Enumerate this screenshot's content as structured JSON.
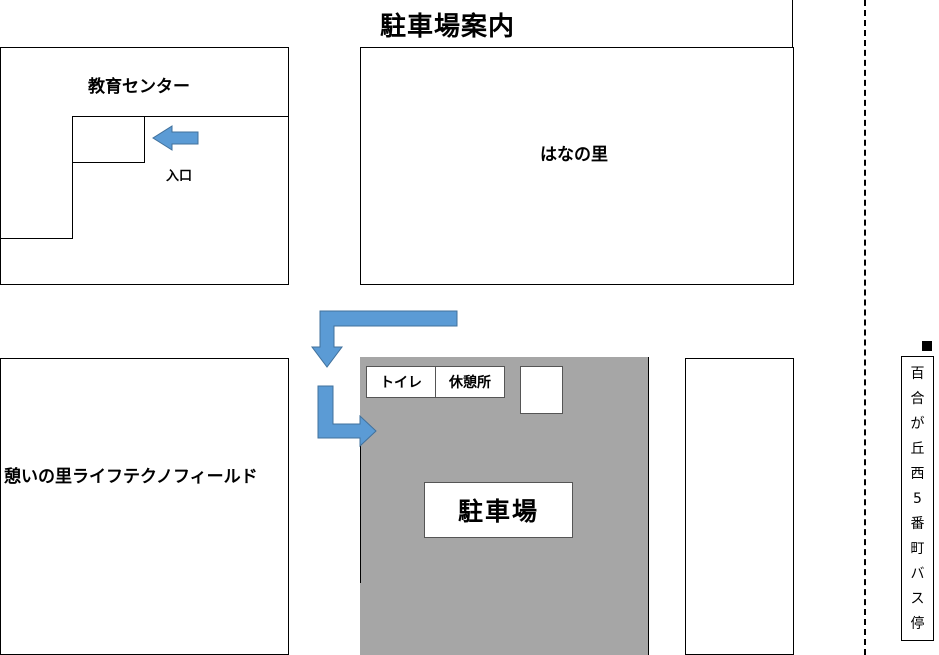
{
  "title": "駐車場案内",
  "buildings": {
    "education_center": "教育センター",
    "entrance": "入口",
    "hana_no_sato": "はなの里",
    "ikoi_no_sato": "憩いの里ライフテクノフィールド",
    "parking": "駐車場",
    "toilet": "トイレ",
    "rest_area": "休憩所"
  },
  "bus_stop": {
    "name_chars": [
      "百",
      "合",
      "が",
      "丘",
      "西",
      "5",
      "番",
      "町",
      "バ",
      "ス",
      "停"
    ]
  },
  "colors": {
    "arrow": "#5b9bd5",
    "arrow_stroke": "#41719c",
    "parking_fill": "#a6a6a6"
  }
}
